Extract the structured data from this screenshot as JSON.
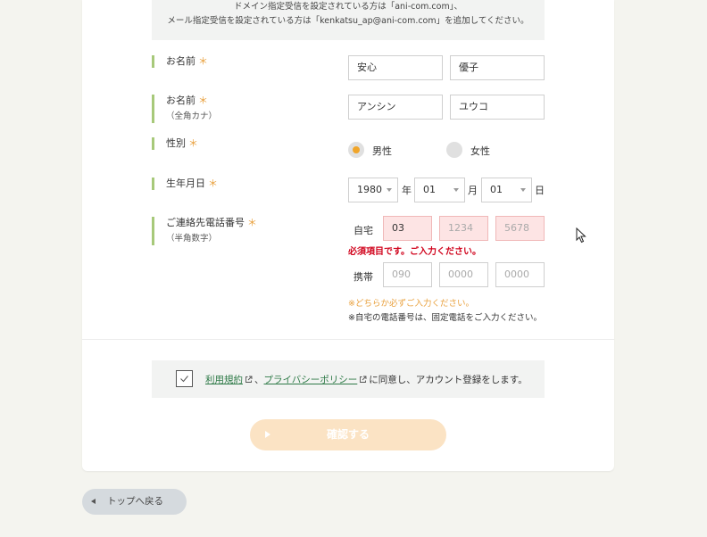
{
  "notice": {
    "line1": "ドメイン指定受信を設定されている方は「ani-com.com」、",
    "line2": "メール指定受信を設定されている方は「kenkatsu_ap@ani-com.com」を追加してください。"
  },
  "required_mark": "＊",
  "name_kanji": {
    "label": "お名前",
    "last": "安心",
    "first": "優子"
  },
  "name_kana": {
    "label": "お名前",
    "sub": "（全角カナ）",
    "last": "アンシン",
    "first": "ユウコ"
  },
  "gender": {
    "label": "性別",
    "male": "男性",
    "female": "女性",
    "selected": "male",
    "accent": "#f0a52a"
  },
  "birthdate": {
    "label": "生年月日",
    "year": "1980",
    "year_unit": "年",
    "month": "01",
    "month_unit": "月",
    "day": "01",
    "day_unit": "日"
  },
  "phone": {
    "label": "ご連絡先電話番号",
    "sub": "（半角数字）",
    "home_label": "自宅",
    "home_1": "03",
    "home_2_placeholder": "1234",
    "home_3_placeholder": "5678",
    "error": "必須項目です。ご入力ください。",
    "mobile_label": "携帯",
    "mobile_1_placeholder": "090",
    "mobile_2_placeholder": "0000",
    "mobile_3_placeholder": "0000",
    "hint_either": "※どちらか必ずご入力ください。",
    "hint_home": "※自宅の電話番号は、固定電話をご入力ください。"
  },
  "agreement": {
    "terms_link": "利用規約",
    "separator": "、",
    "privacy_link": "プライバシーポリシー",
    "tail": "に同意し、アカウント登録をします。",
    "checked": true
  },
  "confirm_button": "確認する",
  "back_button": "トップへ戻る",
  "colors": {
    "accent_orange": "#f0a52a",
    "label_bar": "#a7c97a",
    "error_red": "#d0021b",
    "link_green": "#2e7a47"
  }
}
